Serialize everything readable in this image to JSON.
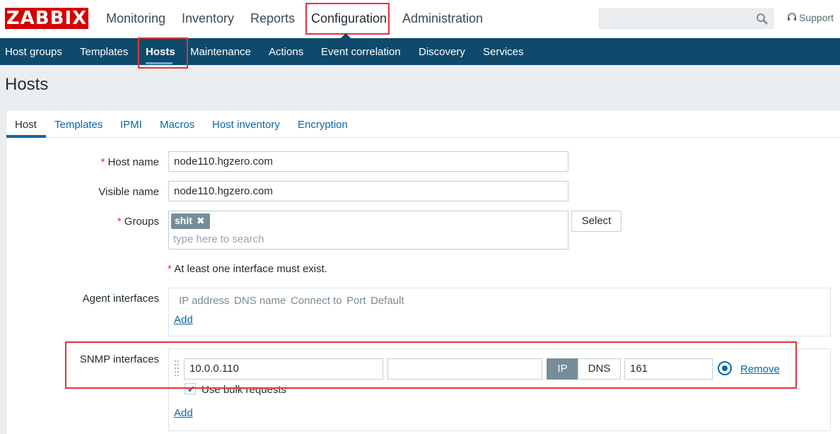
{
  "brand": {
    "logo_text": "ZABBIX"
  },
  "top_nav": {
    "items": [
      "Monitoring",
      "Inventory",
      "Reports",
      "Configuration",
      "Administration"
    ],
    "active": "Configuration",
    "search_placeholder": "",
    "support_label": "Support"
  },
  "sub_nav": {
    "items": [
      "Host groups",
      "Templates",
      "Hosts",
      "Maintenance",
      "Actions",
      "Event correlation",
      "Discovery",
      "Services"
    ],
    "active": "Hosts"
  },
  "page": {
    "title": "Hosts"
  },
  "tabs": {
    "items": [
      "Host",
      "Templates",
      "IPMI",
      "Macros",
      "Host inventory",
      "Encryption"
    ],
    "active": "Host"
  },
  "form": {
    "host_name_label": "Host name",
    "host_name_value": "node110.hgzero.com",
    "visible_name_label": "Visible name",
    "visible_name_value": "node110.hgzero.com",
    "groups_label": "Groups",
    "groups_chip": "shit",
    "groups_placeholder": "type here to search",
    "select_button": "Select",
    "interface_notice": "At least one interface must exist.",
    "required_mark": "*",
    "agent": {
      "label": "Agent interfaces",
      "columns": [
        "IP address",
        "DNS name",
        "Connect to",
        "Port",
        "Default"
      ],
      "add_link": "Add"
    },
    "snmp": {
      "label": "SNMP interfaces",
      "ip_value": "10.0.0.110",
      "dns_value": "",
      "connect_ip": "IP",
      "connect_dns": "DNS",
      "port_value": "161",
      "remove_link": "Remove",
      "bulk_label": "Use bulk requests",
      "bulk_checked": true,
      "add_link": "Add"
    }
  },
  "colors": {
    "brand_red": "#d40000",
    "subnav_bg": "#0e4a6c",
    "link_blue": "#0a67a8",
    "highlight_red": "#e0343a"
  }
}
